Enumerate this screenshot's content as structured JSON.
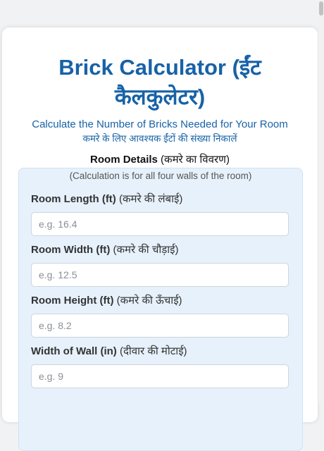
{
  "header": {
    "title": "Brick Calculator (ईंट कैलकुलेटर)",
    "subtitle_en": "Calculate the Number of Bricks Needed for Your Room",
    "subtitle_hi": "कमरे के लिए आवश्यक ईंटों की संख्या निकालें"
  },
  "section": {
    "heading_bold": "Room Details",
    "heading_hi": " (कमरे का विवरण)",
    "note": "(Calculation is for all four walls of the room)"
  },
  "fields": [
    {
      "label_en": "Room Length (ft)",
      "label_hi": " (कमरे की लंबाई)",
      "placeholder": "e.g. 16.4",
      "value": ""
    },
    {
      "label_en": "Room Width (ft)",
      "label_hi": " (कमरे की चौड़ाई)",
      "placeholder": "e.g. 12.5",
      "value": ""
    },
    {
      "label_en": "Room Height (ft)",
      "label_hi": " (कमरे की ऊँचाई)",
      "placeholder": "e.g. 8.2",
      "value": ""
    },
    {
      "label_en": "Width of Wall (in)",
      "label_hi": " (दीवार की मोटाई)",
      "placeholder": "e.g. 9",
      "value": ""
    }
  ],
  "colors": {
    "accent": "#1762a7",
    "panel_bg": "#e6f1fb"
  }
}
